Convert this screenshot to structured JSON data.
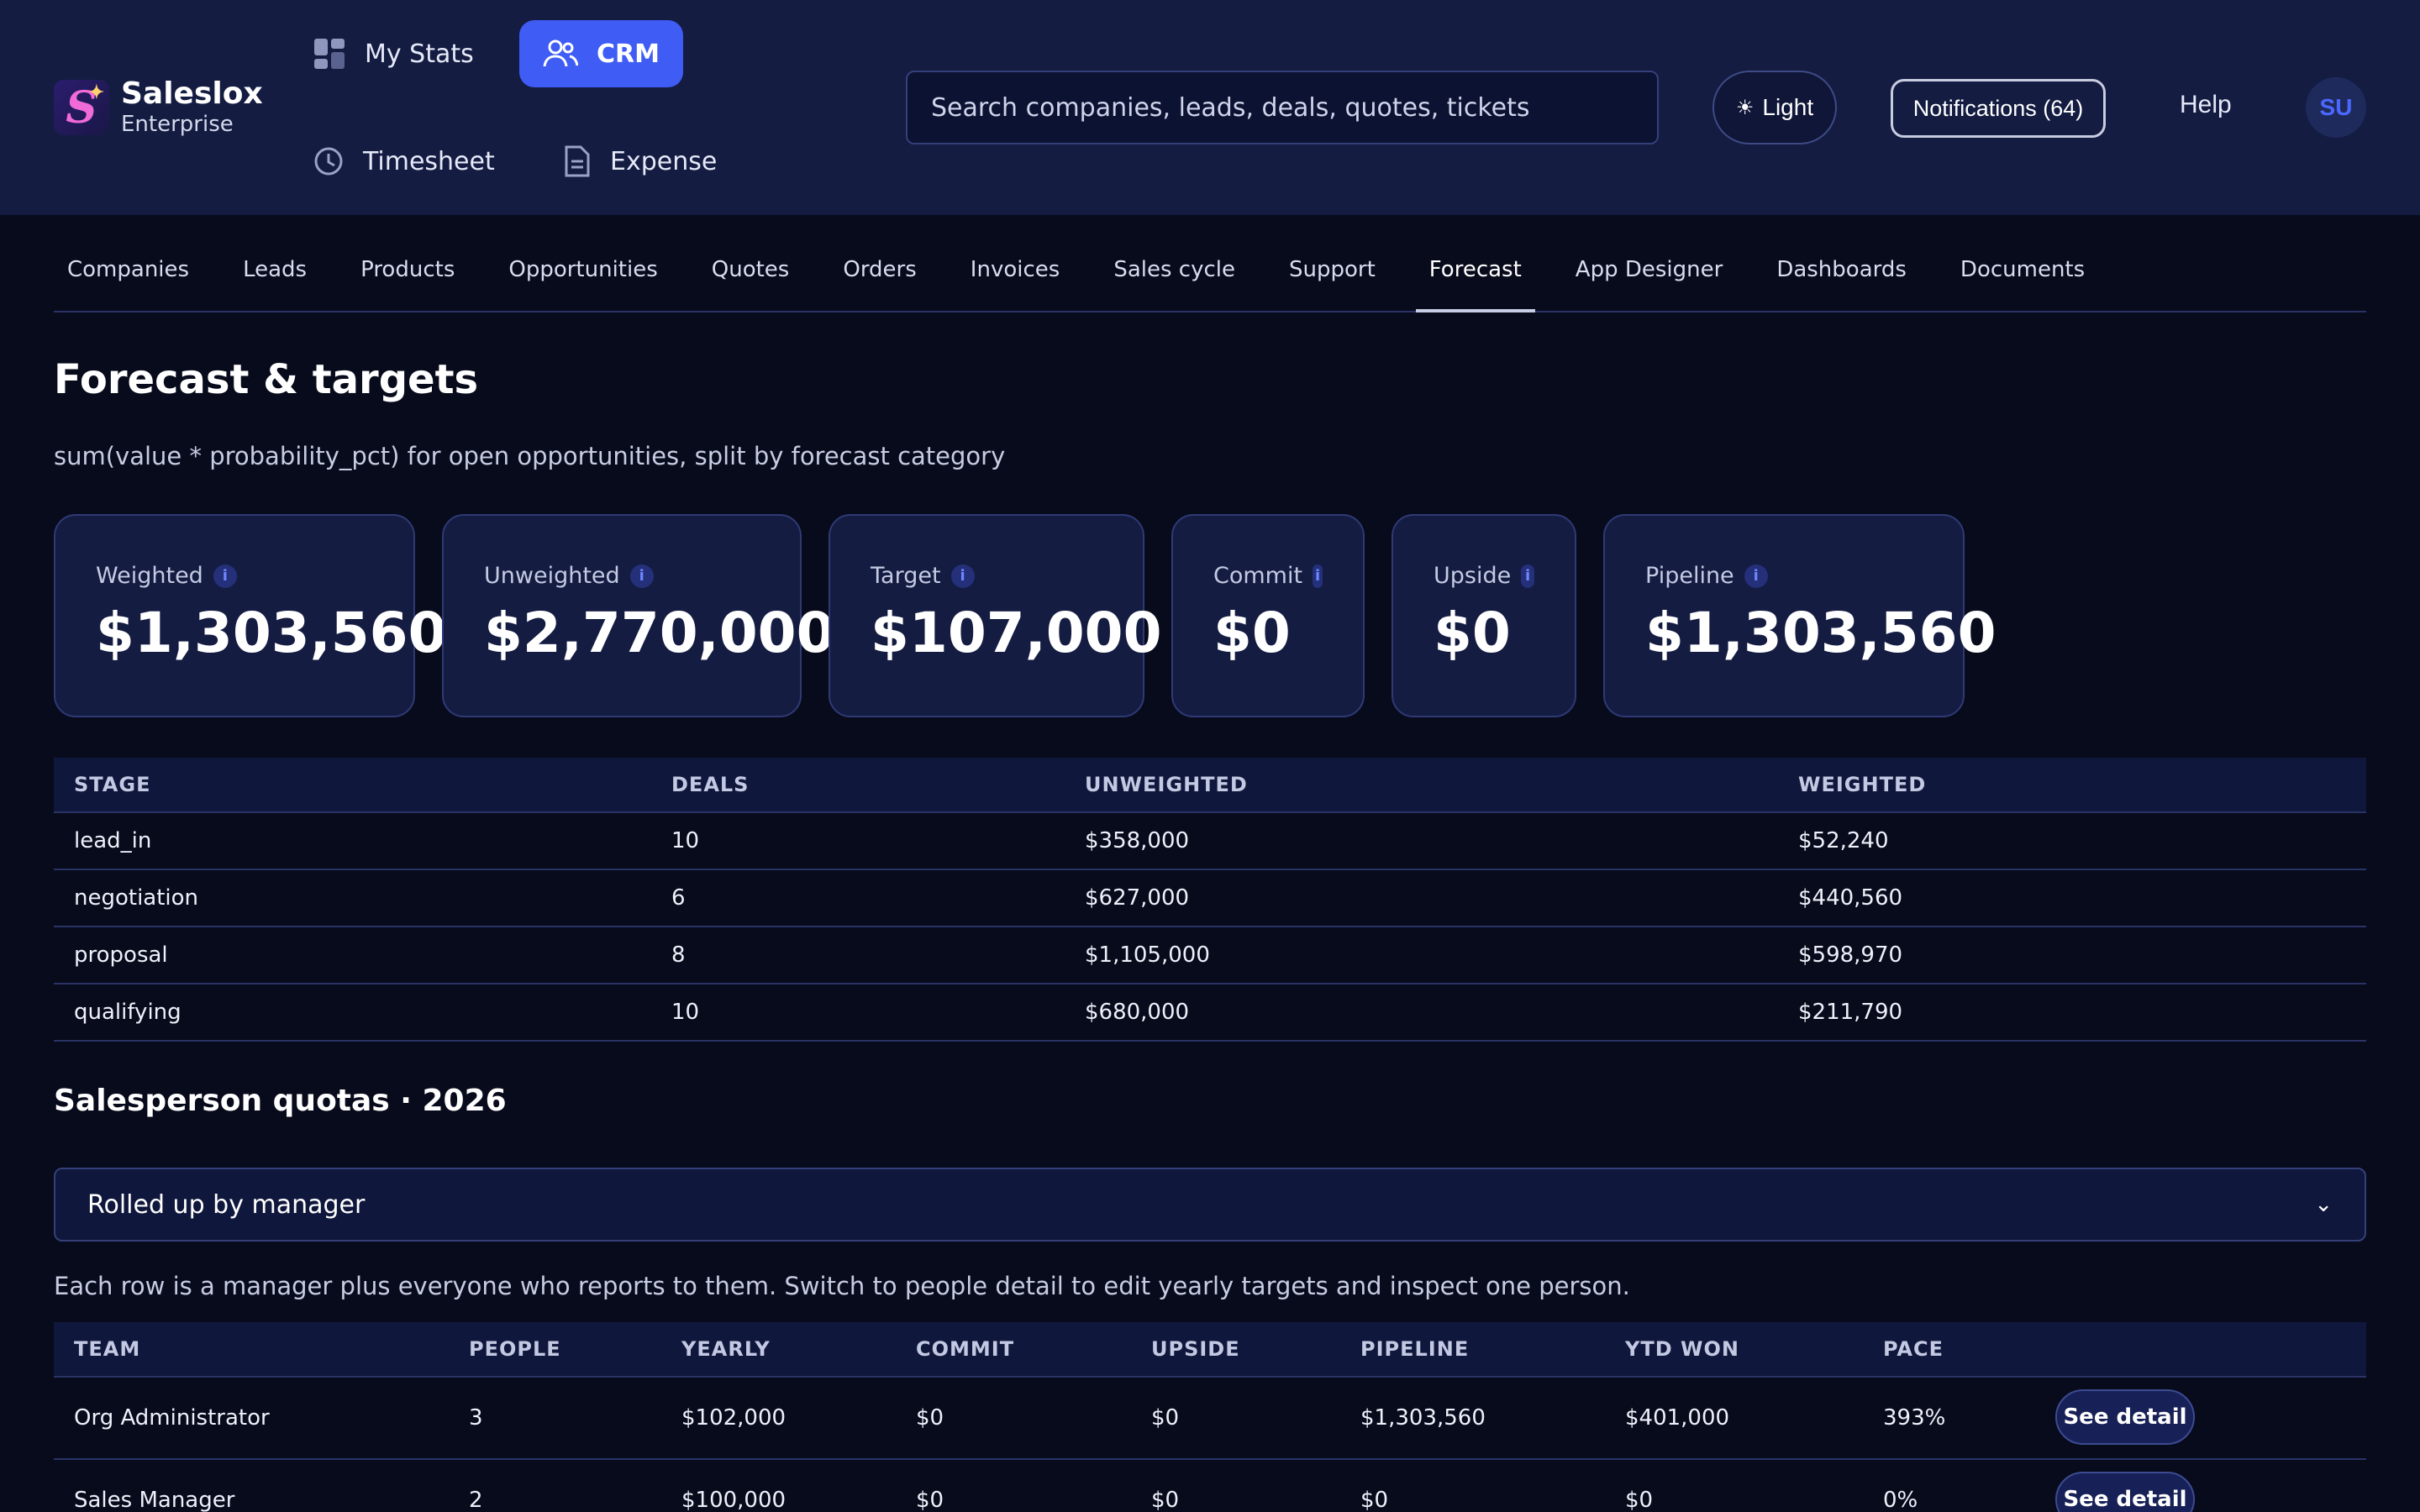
{
  "brand": {
    "name": "Saleslox",
    "edition": "Enterprise",
    "logo_letter": "S",
    "logo_icon": "sparkle-icon"
  },
  "appnav": {
    "my_stats": "My Stats",
    "crm": "CRM",
    "timesheet": "Timesheet",
    "expense": "Expense"
  },
  "search": {
    "placeholder": "Search companies, leads, deals, quotes, tickets"
  },
  "header": {
    "theme_label": "Light",
    "notifications_label": "Notifications (64)",
    "help_label": "Help",
    "avatar_initials": "SU"
  },
  "tabs": [
    "Companies",
    "Leads",
    "Products",
    "Opportunities",
    "Quotes",
    "Orders",
    "Invoices",
    "Sales cycle",
    "Support",
    "Forecast",
    "App Designer",
    "Dashboards",
    "Documents"
  ],
  "active_tab": "Forecast",
  "page": {
    "title": "Forecast & targets",
    "subtitle": "sum(value * probability_pct) for open opportunities, split by forecast category"
  },
  "metrics": [
    {
      "label": "Weighted",
      "value": "$1,303,560"
    },
    {
      "label": "Unweighted",
      "value": "$2,770,000"
    },
    {
      "label": "Target",
      "value": "$107,000"
    },
    {
      "label": "Commit",
      "value": "$0"
    },
    {
      "label": "Upside",
      "value": "$0"
    },
    {
      "label": "Pipeline",
      "value": "$1,303,560"
    }
  ],
  "stage_table": {
    "headers": [
      "STAGE",
      "DEALS",
      "UNWEIGHTED",
      "WEIGHTED"
    ],
    "rows": [
      [
        "lead_in",
        "10",
        "$358,000",
        "$52,240"
      ],
      [
        "negotiation",
        "6",
        "$627,000",
        "$440,560"
      ],
      [
        "proposal",
        "8",
        "$1,105,000",
        "$598,970"
      ],
      [
        "qualifying",
        "10",
        "$680,000",
        "$211,790"
      ]
    ]
  },
  "quotas": {
    "title": "Salesperson quotas · 2026",
    "view_select": "Rolled up by manager",
    "helper": "Each row is a manager plus everyone who reports to them. Switch to people detail to edit yearly targets and inspect one person.",
    "headers": [
      "TEAM",
      "PEOPLE",
      "YEARLY",
      "COMMIT",
      "UPSIDE",
      "PIPELINE",
      "YTD WON",
      "PACE"
    ],
    "detail_label": "See detail",
    "rows": [
      [
        "Org Administrator",
        "3",
        "$102,000",
        "$0",
        "$0",
        "$1,303,560",
        "$401,000",
        "393%"
      ],
      [
        "Sales Manager",
        "2",
        "$100,000",
        "$0",
        "$0",
        "$0",
        "$0",
        "0%"
      ]
    ]
  },
  "colors": {
    "accent": "#3f5cf5",
    "background": "#080b1c",
    "header": "#141c42"
  }
}
